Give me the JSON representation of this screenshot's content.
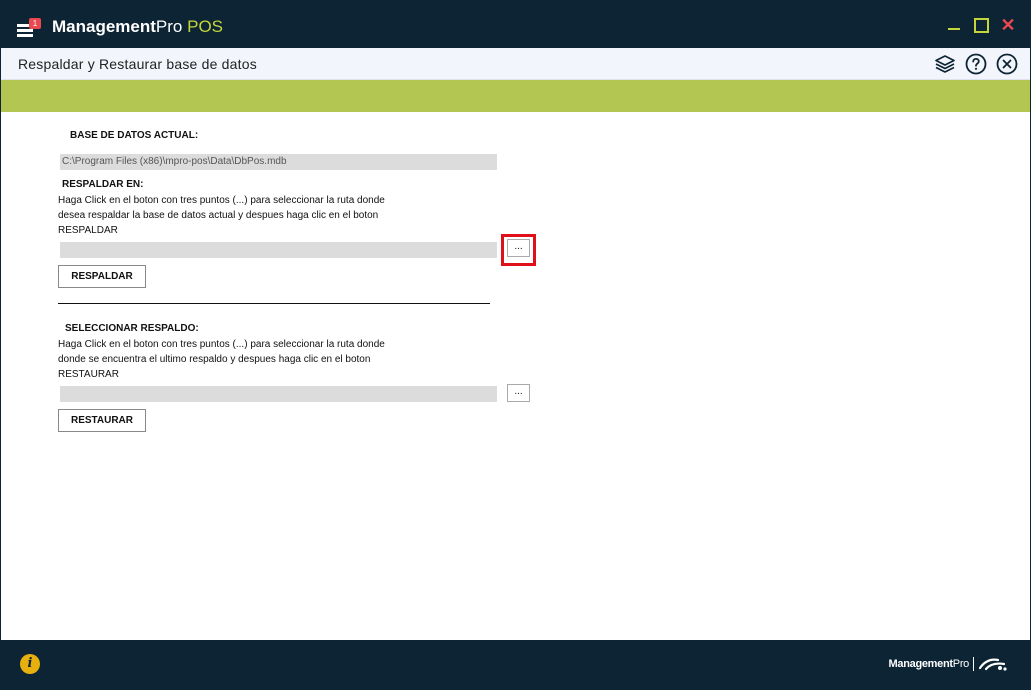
{
  "window": {
    "app_name_bold": "Management",
    "app_name_regular": "Pro ",
    "app_name_accent": "POS",
    "notification_count": "1"
  },
  "header": {
    "title": "Respaldar y Restaurar base de datos",
    "icons": [
      "layers-icon",
      "help-icon",
      "close-circle-icon"
    ]
  },
  "current_db": {
    "label": "BASE DE DATOS ACTUAL:",
    "path": "C:\\Program Files (x86)\\mpro-pos\\Data\\DbPos.mdb"
  },
  "backup": {
    "label": "RESPALDAR EN:",
    "instructions_line1": "Haga Click en el boton con tres puntos (...) para seleccionar la ruta donde",
    "instructions_line2": "desea respaldar la base de datos actual y despues haga clic en el boton",
    "instructions_line3": "RESPALDAR",
    "path": "",
    "browse_label": "...",
    "button_label": "RESPALDAR"
  },
  "restore": {
    "label": "SELECCIONAR RESPALDO:",
    "instructions_line1": "Haga Click en el boton con tres puntos (...) para seleccionar la ruta donde",
    "instructions_line2": "donde se encuentra el ultimo respaldo y despues haga clic en el boton",
    "instructions_line3": "RESTAURAR",
    "path": "",
    "browse_label": "...",
    "button_label": "RESTAURAR"
  },
  "footer": {
    "brand_bold": "Management",
    "brand_regular": "Pro",
    "info_glyph": "i"
  },
  "colors": {
    "titlebar": "#0c2433",
    "accent_green": "#b3c651",
    "pos_accent": "#c5d63a",
    "highlight_red": "#e0101a",
    "info_yellow": "#e8b00e"
  }
}
